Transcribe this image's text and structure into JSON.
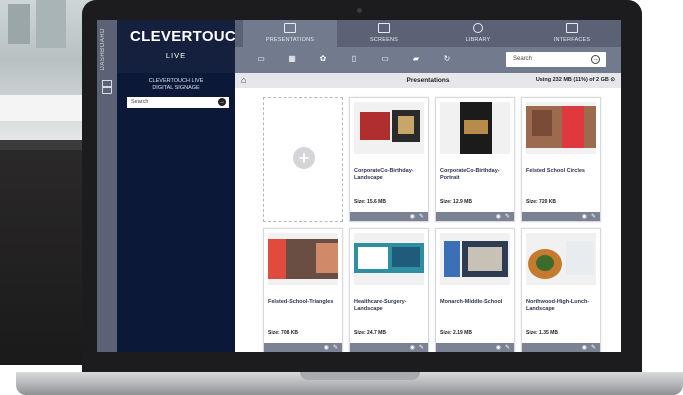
{
  "app": {
    "dashboard_label": "DASHBOARD",
    "brand": "CLEVERTOUCH",
    "brand_sup": "®",
    "brand_sub": "LIVE"
  },
  "topnav": {
    "tabs": [
      {
        "label": "PRESENTATIONS",
        "icon": "presentation-icon",
        "active": true
      },
      {
        "label": "SCREENS",
        "icon": "monitor-icon",
        "active": false
      },
      {
        "label": "LIBRARY",
        "icon": "library-icon",
        "active": false
      },
      {
        "label": "INTERFACES",
        "icon": "interfaces-icon",
        "active": false
      }
    ]
  },
  "toolbar": {
    "search_placeholder": "Search"
  },
  "leftpanel": {
    "title_line1": "CLEVERTOUCH LIVE",
    "title_line2": "DIGITAL SIGNAGE",
    "search_placeholder": "Search"
  },
  "main": {
    "breadcrumb_title": "Presentations",
    "usage": "Using 232 MB (11%) of 2 GB"
  },
  "cards": [
    {
      "name": "CorporateCo-Birthday-Landscape",
      "size": "Size: 15.6 MB"
    },
    {
      "name": "CorporateCo-Birthday-Portrait",
      "size": "Size: 12.9 MB"
    },
    {
      "name": "Felsted School Circles",
      "size": "Size: 720 KB"
    },
    {
      "name": "Felsted-School-Triangles",
      "size": "Size: 708 KB"
    },
    {
      "name": "Healthcare-Surgery-Landscape",
      "size": "Size: 24.7 MB"
    },
    {
      "name": "Monarch-Middle-School",
      "size": "Size: 2.19 MB"
    },
    {
      "name": "Northwood-High-Lunch-Landscape",
      "size": "Size: 1.35 MB"
    }
  ],
  "colors": {
    "navy": "#15203e",
    "nav_grey": "#5b6275",
    "toolbar_grey": "#727a8e"
  }
}
